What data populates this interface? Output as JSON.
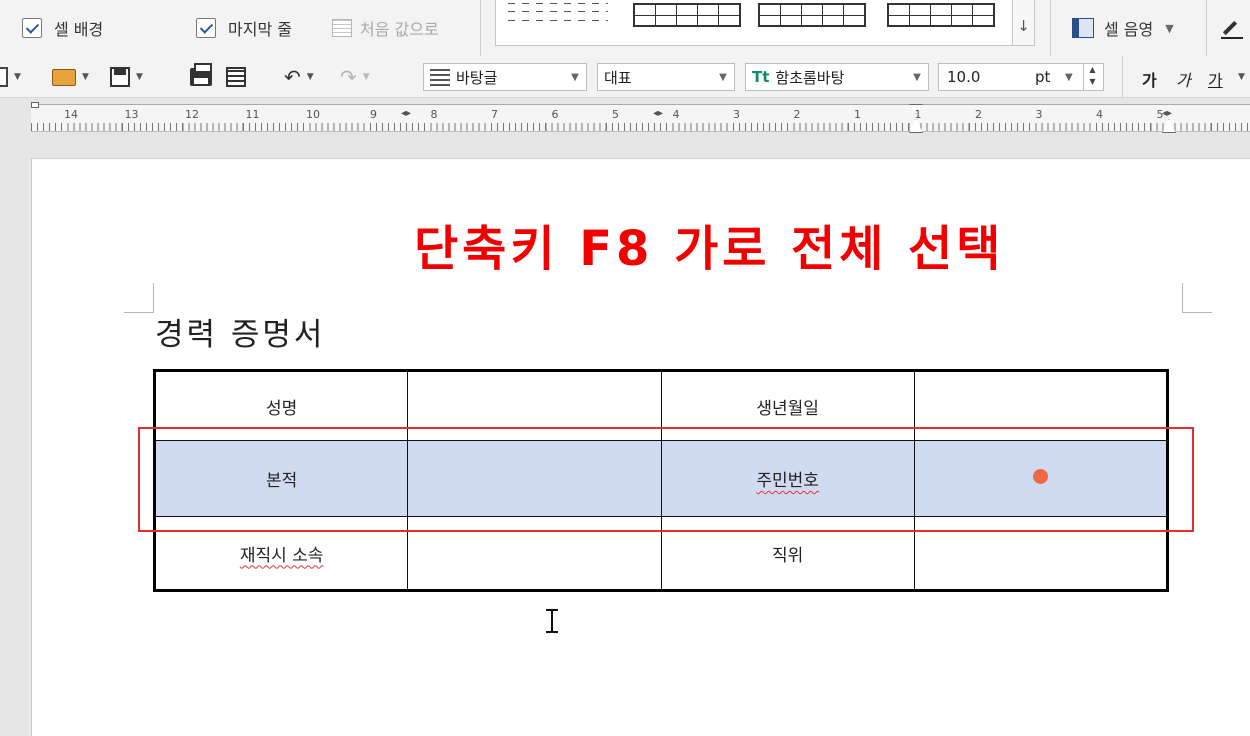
{
  "toolbar_top": {
    "cell_background_label": "셀 배경",
    "cell_background_checked": true,
    "last_line_label": "마지막 줄",
    "last_line_checked": true,
    "reset_label": "처음 값으로",
    "cell_shade_label": "셀 음영"
  },
  "toolbar_main": {
    "style_value": "바탕글",
    "outline_value": "대표",
    "font_value": "함초롬바탕",
    "font_icon": "Tt",
    "size_value": "10.0",
    "size_unit": "pt",
    "bold_label": "가",
    "italic_label": "가",
    "underline_label": "가"
  },
  "ruler": {
    "numbers": [
      "14",
      "13",
      "12",
      "11",
      "10",
      "9",
      "8",
      "7",
      "6",
      "5",
      "4",
      "3",
      "2",
      "1",
      "1",
      "2",
      "3",
      "4",
      "5"
    ]
  },
  "document": {
    "overlay_annotation": "단축키 F8 가로 전체 선택",
    "title": "경력 증명서",
    "rows": [
      [
        "성명",
        "",
        "생년월일",
        ""
      ],
      [
        "본적",
        "",
        "주민번호",
        ""
      ],
      [
        "재직시 소속",
        "",
        "직위",
        ""
      ]
    ]
  },
  "colors": {
    "selection_fill": "#d0dbf2",
    "annotation_red": "#f20000",
    "frame_red": "#e03030",
    "cursor_dot": "#ef6a43"
  }
}
